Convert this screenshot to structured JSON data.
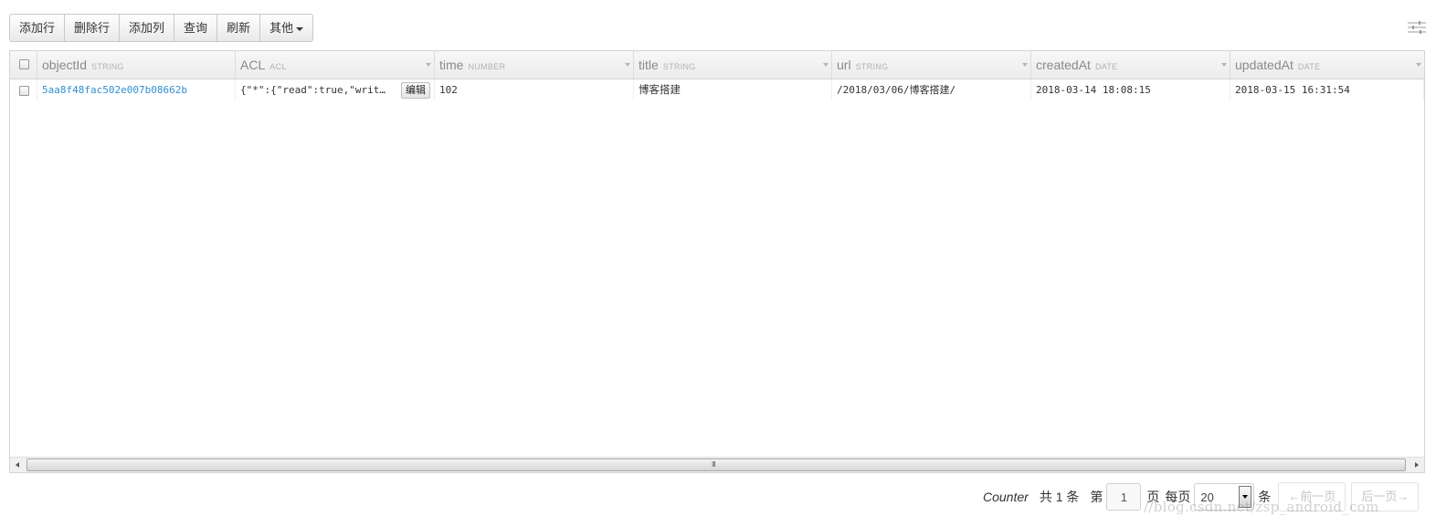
{
  "toolbar": {
    "add_row": "添加行",
    "delete_row": "删除行",
    "add_column": "添加列",
    "query": "查询",
    "refresh": "刷新",
    "more": "其他"
  },
  "columns": [
    {
      "name": "objectId",
      "type": "STRING"
    },
    {
      "name": "ACL",
      "type": "ACL"
    },
    {
      "name": "time",
      "type": "NUMBER"
    },
    {
      "name": "title",
      "type": "STRING"
    },
    {
      "name": "url",
      "type": "STRING"
    },
    {
      "name": "createdAt",
      "type": "DATE"
    },
    {
      "name": "updatedAt",
      "type": "DATE"
    }
  ],
  "rows": [
    {
      "objectId": "5aa8f48fac502e007b08662b",
      "acl": "{\"*\":{\"read\":true,\"writ…",
      "acl_edit": "编辑",
      "time": "102",
      "title": "博客搭建",
      "url": "/2018/03/06/博客搭建/",
      "createdAt": "2018-03-14 18:08:15",
      "updatedAt": "2018-03-15 16:31:54"
    }
  ],
  "pager": {
    "class_name": "Counter",
    "total_text": "共 1 条",
    "page_prefix": "第",
    "current_page": "1",
    "page_suffix": "页",
    "per_page_label": "每页",
    "per_page_value": "20",
    "per_page_suffix": "条",
    "prev": "←前一页",
    "next": "后一页→"
  },
  "watermark": "//blog.csdn.net/zsp_android_com",
  "icons": {
    "settings": "sliders-icon",
    "column_menu": "chevron-down-icon"
  },
  "colors": {
    "link": "#2f8fd1",
    "header_text": "#8a8a8a",
    "type_text": "#b3b3b3"
  }
}
